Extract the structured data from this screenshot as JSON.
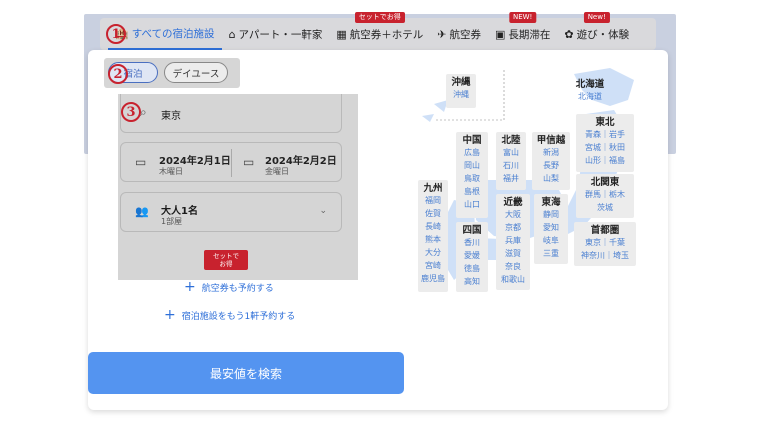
{
  "tabs": [
    {
      "label": "すべての宿泊施設",
      "icon": "hotel-icon",
      "active": true
    },
    {
      "label": "アパート・一軒家",
      "icon": "house-icon",
      "active": false
    },
    {
      "label": "航空券＋ホテル",
      "icon": "package-icon",
      "badge": "セットでお得",
      "active": false
    },
    {
      "label": "航空券",
      "icon": "airplane-icon",
      "active": false
    },
    {
      "label": "長期滞在",
      "icon": "calendar-icon",
      "badge": "NEW!",
      "active": false
    },
    {
      "label": "遊び・体験",
      "icon": "activity-icon",
      "badge": "New!",
      "active": false
    }
  ],
  "annotations": [
    "1",
    "2",
    "3"
  ],
  "stay_type": {
    "stay": "宿泊",
    "dayuse": "デイユース"
  },
  "destination": {
    "value": "東京"
  },
  "dates": {
    "checkin": "2024年2月1日",
    "checkin_dow": "木曜日",
    "checkout": "2024年2月2日",
    "checkout_dow": "金曜日"
  },
  "guests": {
    "main": "大人1名",
    "rooms": "1部屋"
  },
  "set_badge": "セットで\nお得",
  "links": {
    "add_flight": "航空券も予約する",
    "add_hotel": "宿泊施設をもう1軒予約する"
  },
  "search_button": "最安値を検索",
  "map": {
    "regions": [
      {
        "name": "沖縄",
        "prefs": [
          "沖縄"
        ]
      },
      {
        "name": "北海道",
        "prefs": [
          "北海道"
        ]
      },
      {
        "name": "東北",
        "prefs": [
          "青森｜岩手",
          "宮城｜秋田",
          "山形｜福島"
        ]
      },
      {
        "name": "中国",
        "prefs": [
          "広島",
          "岡山",
          "鳥取",
          "島根",
          "山口"
        ]
      },
      {
        "name": "北陸",
        "prefs": [
          "富山",
          "石川",
          "福井"
        ]
      },
      {
        "name": "甲信越",
        "prefs": [
          "新潟",
          "長野",
          "山梨"
        ]
      },
      {
        "name": "北関東",
        "prefs": [
          "群馬｜栃木",
          "茨城"
        ]
      },
      {
        "name": "九州",
        "prefs": [
          "福岡",
          "佐賀",
          "長崎",
          "熊本",
          "大分",
          "宮崎",
          "鹿児島"
        ]
      },
      {
        "name": "近畿",
        "prefs": [
          "大阪",
          "京都",
          "兵庫",
          "滋賀",
          "奈良",
          "和歌山"
        ]
      },
      {
        "name": "東海",
        "prefs": [
          "静岡",
          "愛知",
          "岐阜",
          "三重"
        ]
      },
      {
        "name": "四国",
        "prefs": [
          "香川",
          "愛媛",
          "徳島",
          "高知"
        ]
      },
      {
        "name": "首都圏",
        "prefs": [
          "東京｜千葉",
          "神奈川｜埼玉"
        ]
      }
    ]
  },
  "colors": {
    "accent": "#2e6fd8",
    "button": "#5494f0",
    "badge": "#c8222e",
    "link": "#4a7fd1"
  }
}
